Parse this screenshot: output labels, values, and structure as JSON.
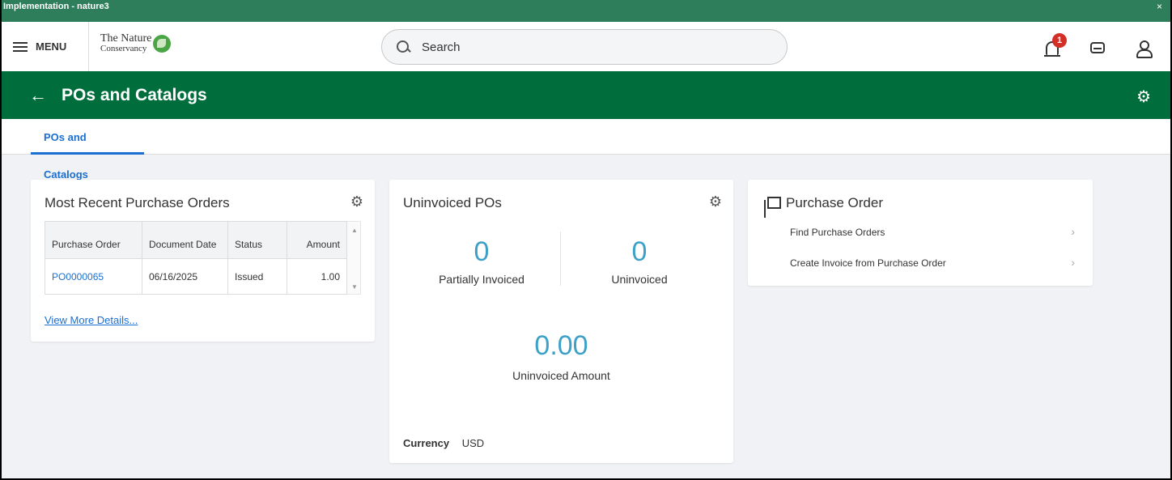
{
  "env_bar": {
    "title": "Implementation - nature3",
    "close": "×"
  },
  "topnav": {
    "menu_label": "MENU",
    "logo_line1": "The Nature",
    "logo_line2": "Conservancy",
    "search_placeholder": "Search",
    "notification_count": "1"
  },
  "page": {
    "title": "POs and Catalogs",
    "tabs": [
      {
        "label": "POs and Catalogs",
        "active": true
      }
    ]
  },
  "recent_pos": {
    "title": "Most Recent Purchase Orders",
    "columns": [
      "Purchase Order",
      "Document Date",
      "Status",
      "Amount"
    ],
    "rows": [
      {
        "po": "PO0000065",
        "date": "06/16/2025",
        "status": "Issued",
        "amount": "1.00"
      }
    ],
    "view_more": "View More Details..."
  },
  "uninvoiced": {
    "title": "Uninvoiced POs",
    "partially_invoiced_value": "0",
    "partially_invoiced_label": "Partially Invoiced",
    "uninvoiced_value": "0",
    "uninvoiced_label": "Uninvoiced",
    "amount_value": "0.00",
    "amount_label": "Uninvoiced Amount",
    "currency_label": "Currency",
    "currency_value": "USD"
  },
  "purchase_order": {
    "title": "Purchase Order",
    "links": [
      "Find Purchase Orders",
      "Create Invoice from Purchase Order"
    ]
  },
  "colors": {
    "env_bar": "#2e7d5b",
    "header": "#006e3c",
    "accent_blue": "#1b6fd0",
    "metric_blue": "#3ca0c7",
    "badge_red": "#d22f27"
  }
}
